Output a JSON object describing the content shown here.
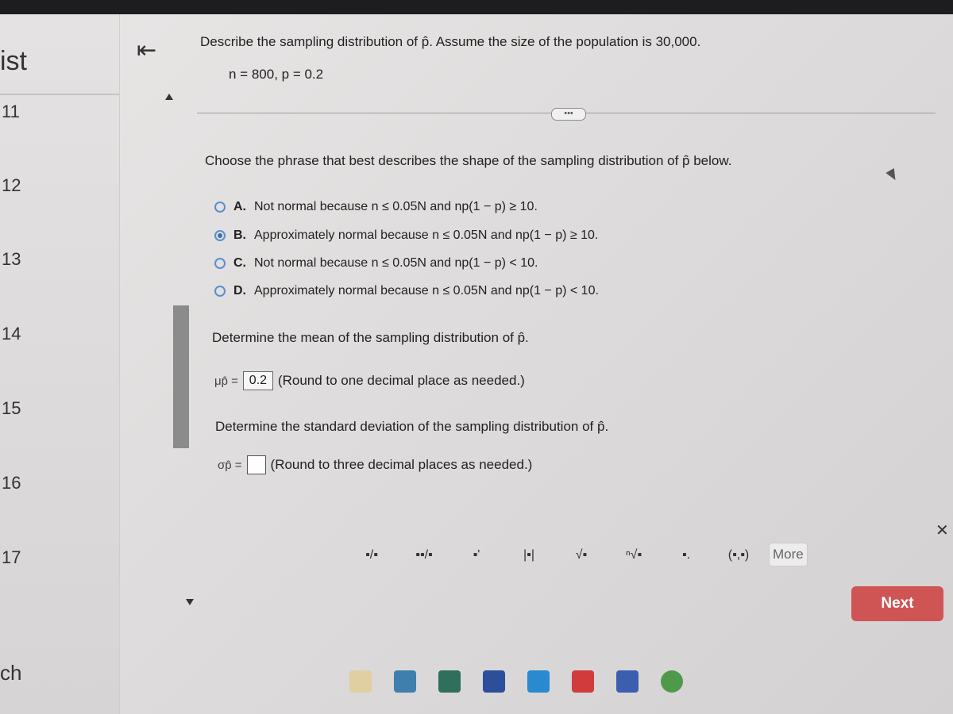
{
  "sidebar": {
    "title": "ist",
    "questions": [
      "11",
      "12",
      "13",
      "14",
      "15",
      "16",
      "17"
    ],
    "bottom_label": "ch"
  },
  "question": {
    "header": "Describe the sampling distribution of p̂. Assume the size of the population is 30,000.",
    "params": "n = 800, p = 0.2",
    "more_indicator": "•••"
  },
  "shape": {
    "prompt": "Choose the phrase that best describes the shape of the sampling distribution of p̂ below.",
    "selected": "B",
    "options": [
      {
        "letter": "A.",
        "text": "Not normal because n ≤ 0.05N and np(1 − p) ≥ 10."
      },
      {
        "letter": "B.",
        "text": "Approximately normal because n ≤ 0.05N and np(1 − p) ≥ 10."
      },
      {
        "letter": "C.",
        "text": "Not normal because n ≤ 0.05N and np(1 − p) < 10."
      },
      {
        "letter": "D.",
        "text": "Approximately normal because n ≤ 0.05N and np(1 − p) < 10."
      }
    ]
  },
  "mean": {
    "prompt": "Determine the mean of the sampling distribution of p̂.",
    "symbol": "μp̂ =",
    "value": "0.2",
    "hint": "(Round to one decimal place as needed.)"
  },
  "sd": {
    "prompt": "Determine the standard deviation of the sampling distribution of p̂.",
    "symbol": "σp̂ =",
    "value": "",
    "hint": "(Round to three decimal places as needed.)"
  },
  "toolbar": {
    "tools": [
      "fraction-icon",
      "mixed-number-icon",
      "superscript-icon",
      "absolute-value-icon",
      "sqrt-icon",
      "nth-root-icon",
      "decimal-icon",
      "ordered-pair-icon"
    ],
    "tool_glyphs": [
      "▪/▪",
      "▪▪/▪",
      "▪'",
      "|▪|",
      "√▪",
      "ⁿ√▪",
      "▪.",
      "(▪,▪)"
    ],
    "more_label": "More"
  },
  "nav": {
    "next_label": "Next",
    "collapse_glyph": "⇤",
    "close_glyph": "✕"
  },
  "colors": {
    "accent": "#3a6fb5",
    "next_button": "#cf5454"
  }
}
